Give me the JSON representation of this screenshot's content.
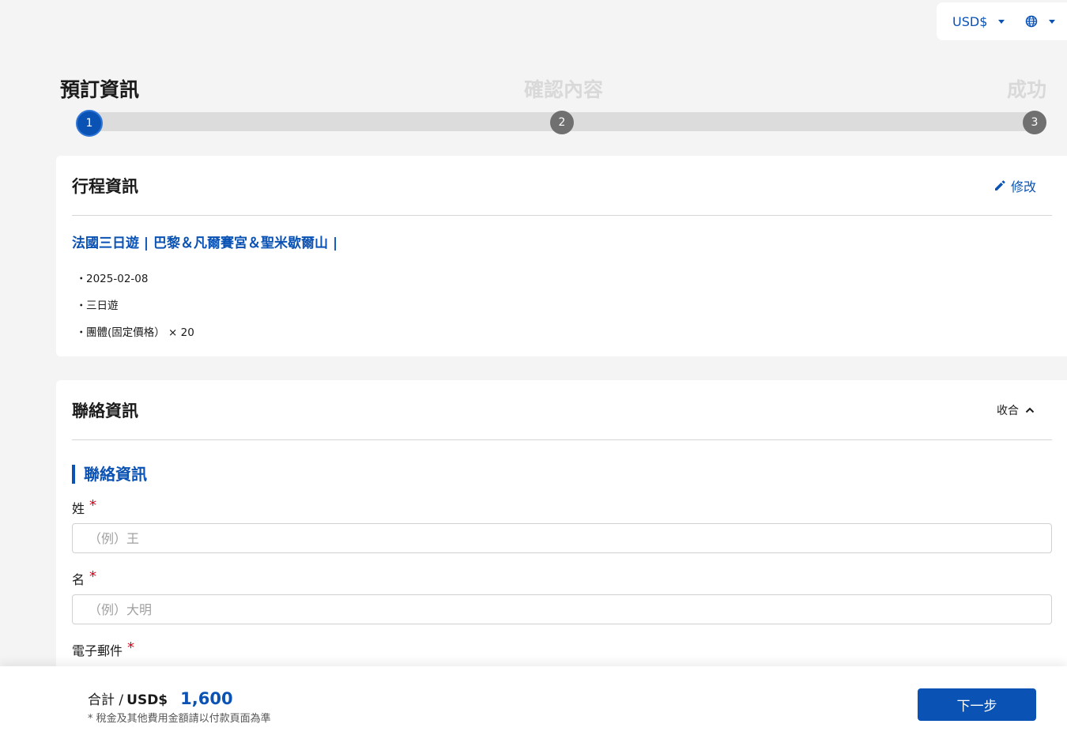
{
  "topbar": {
    "currency": "USD$",
    "currency_icon": "caret-down-icon",
    "language_icon": "globe-icon"
  },
  "steps": [
    {
      "label": "預訂資訊",
      "number": "1",
      "state": "active"
    },
    {
      "label": "確認內容",
      "number": "2",
      "state": "pending"
    },
    {
      "label": "成功",
      "number": "3",
      "state": "pending"
    }
  ],
  "trip": {
    "title": "行程資訊",
    "edit_label": "修改",
    "name": "法國三日遊 | 巴黎＆凡爾賽宮＆聖米歇爾山 |",
    "details": [
      "2025-02-08",
      "三日遊",
      "團體(固定價格） × 20"
    ]
  },
  "contact": {
    "title": "聯絡資訊",
    "collapse_label": "收合",
    "section_title": "聯絡資訊",
    "fields": [
      {
        "label": "姓",
        "placeholder": "（例）王"
      },
      {
        "label": "名",
        "placeholder": "（例）大明"
      },
      {
        "label": "電子郵件",
        "placeholder": ""
      }
    ]
  },
  "footer": {
    "total_label": "合計 /",
    "currency": "USD$",
    "amount": "1,600",
    "tax_note": "* 稅金及其他費用金額請以付款頁面為準",
    "next_label": "下一步"
  },
  "colors": {
    "accent": "#0a52b4",
    "required": "#d0021b",
    "inactive_step": "#707070"
  }
}
